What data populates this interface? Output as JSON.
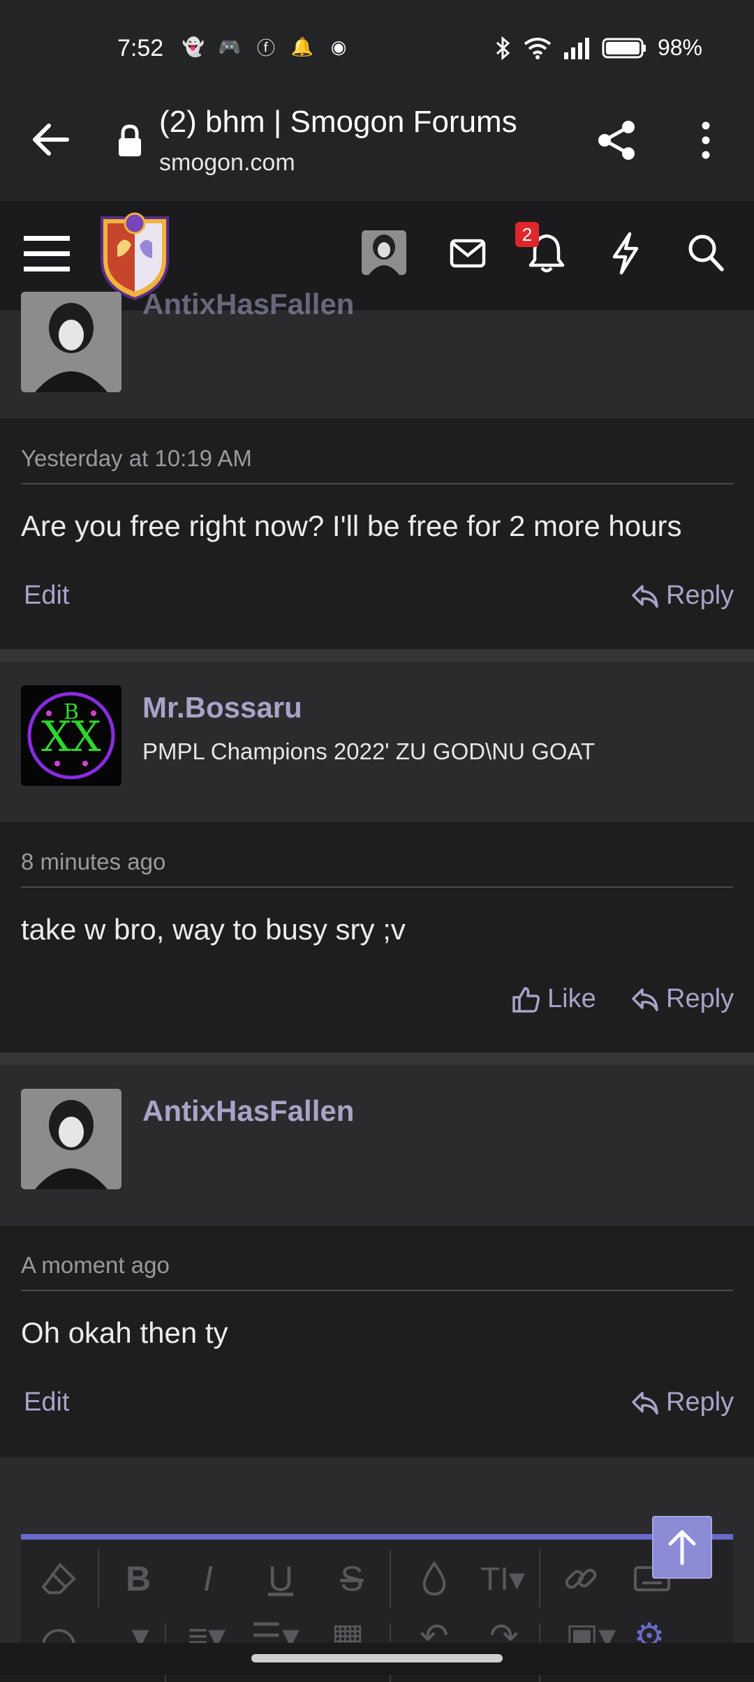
{
  "status_bar": {
    "time": "7:52",
    "battery": "98%",
    "notification_icons": [
      "snapchat-icon",
      "discord-icon",
      "facebook-icon",
      "bell-icon",
      "app-icon"
    ],
    "right_icons": [
      "bluetooth-icon",
      "wifi-icon",
      "signal-icon",
      "battery-icon"
    ]
  },
  "browser": {
    "page_title": "(2) bhm | Smogon Forums",
    "domain": "smogon.com"
  },
  "site_header": {
    "notification_count": "2"
  },
  "messages": [
    {
      "username": "AntixHasFallen",
      "user_title": "",
      "date": "Yesterday at 10:19 AM",
      "text": "Are you free right now? I'll be free for 2 more hours",
      "left_action": "Edit",
      "right_action": "Reply"
    },
    {
      "username": "Mr.Bossaru",
      "user_title": "PMPL Champions 2022' ZU GOD\\NU GOAT",
      "date": "8 minutes ago",
      "text": "take w bro, way to busy sry ;v",
      "left_action": "Like",
      "right_action": "Reply"
    },
    {
      "username": "AntixHasFallen",
      "user_title": "",
      "date": "A moment ago",
      "text": "Oh okah then ty",
      "left_action": "Edit",
      "right_action": "Reply"
    }
  ],
  "colors": {
    "accent": "#a8a4c8",
    "editor_bar": "#6a6acb",
    "badge": "#e0262d"
  }
}
